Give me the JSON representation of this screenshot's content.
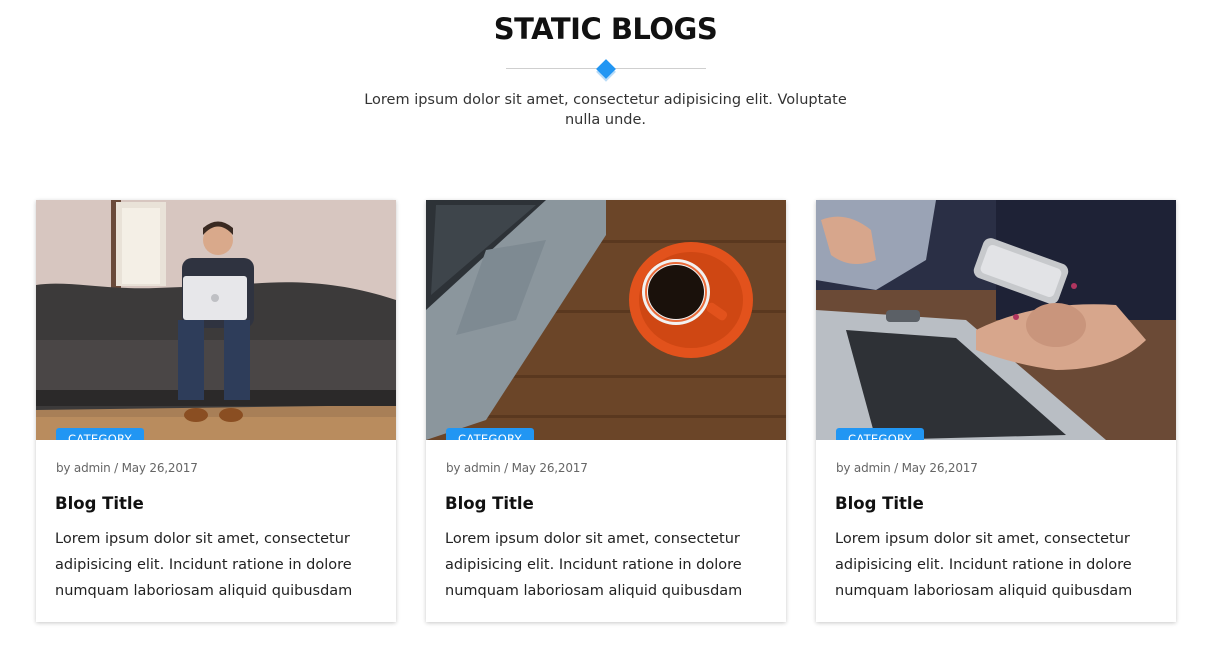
{
  "header": {
    "title": "STATIC BLOGS",
    "subtitle": "Lorem ipsum dolor sit amet, consectetur adipisicing elit. Voluptate nulla unde."
  },
  "colors": {
    "accent": "#2196f3"
  },
  "cards": [
    {
      "category": "CATEGORY",
      "meta": "by admin / May 26,2017",
      "title": "Blog Title",
      "excerpt": "Lorem ipsum dolor sit amet, consectetur adipisicing elit. Incidunt ratione in dolore numquam laboriosam aliquid quibusdam",
      "image": "man-with-laptop-on-sofa"
    },
    {
      "category": "CATEGORY",
      "meta": "by admin / May 26,2017",
      "title": "Blog Title",
      "excerpt": "Lorem ipsum dolor sit amet, consectetur adipisicing elit. Incidunt ratione in dolore numquam laboriosam aliquid quibusdam",
      "image": "laptop-and-coffee-on-desk"
    },
    {
      "category": "CATEGORY",
      "meta": "by admin / May 26,2017",
      "title": "Blog Title",
      "excerpt": "Lorem ipsum dolor sit amet, consectetur adipisicing elit. Incidunt ratione in dolore numquam laboriosam aliquid quibusdam",
      "image": "hands-with-phone-and-laptop"
    }
  ]
}
